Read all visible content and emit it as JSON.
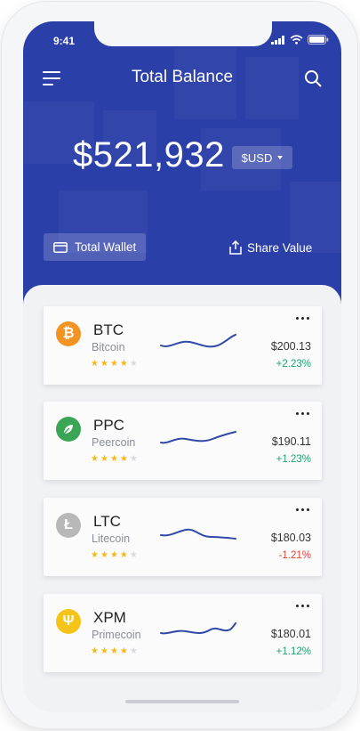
{
  "status_bar": {
    "time": "9:41"
  },
  "header": {
    "title": "Total Balance",
    "balance": "$521,932",
    "currency": "$USD",
    "total_wallet_label": "Total Wallet",
    "share_value_label": "Share Value"
  },
  "colors": {
    "header_bg": "#2b3fa8",
    "star_on": "#f5b81c",
    "star_off": "#d9dbe0",
    "positive": "#1fa372",
    "negative": "#e0453a",
    "sparkline": "#3148a8"
  },
  "coins": [
    {
      "symbol": "BTC",
      "name": "Bitcoin",
      "price": "$200.13",
      "change": "+2.23%",
      "trend": "up",
      "rating": 4,
      "icon": "bitcoin-icon",
      "icon_glyph": "₿",
      "icon_color": "#f39323"
    },
    {
      "symbol": "PPC",
      "name": "Peercoin",
      "price": "$190.11",
      "change": "+1.23%",
      "trend": "up",
      "rating": 4,
      "icon": "peercoin-icon",
      "icon_glyph": "",
      "icon_color": "#3aa655"
    },
    {
      "symbol": "LTC",
      "name": "Litecoin",
      "price": "$180.03",
      "change": "-1.21%",
      "trend": "down",
      "rating": 4,
      "icon": "litecoin-icon",
      "icon_glyph": "Ł",
      "icon_color": "#b8b8b8"
    },
    {
      "symbol": "XPM",
      "name": "Primecoin",
      "price": "$180.01",
      "change": "+1.12%",
      "trend": "up",
      "rating": 4,
      "icon": "primecoin-icon",
      "icon_glyph": "Ψ",
      "icon_color": "#f5c418"
    }
  ]
}
